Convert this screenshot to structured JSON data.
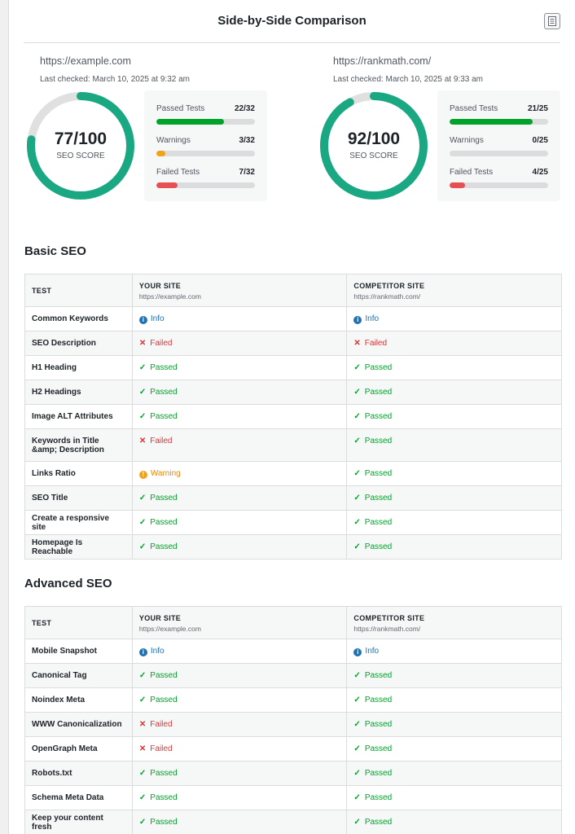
{
  "title": "Side-by-Side Comparison",
  "colors": {
    "passed": "#00a32a",
    "failed": "#d63638",
    "warning": "#f0a31a",
    "info": "#2271b1",
    "gauge": "#19a882"
  },
  "sites": [
    {
      "url": "https://example.com",
      "last_checked": "Last checked: March 10, 2025 at 9:32 am",
      "score": "77/100",
      "score_value": 77,
      "score_label": "SEO SCORE",
      "stats": [
        {
          "label": "Passed Tests",
          "value": "22/32",
          "fraction": 0.6875,
          "color": "#00a32a"
        },
        {
          "label": "Warnings",
          "value": "3/32",
          "fraction": 0.094,
          "color": "#f0a31a"
        },
        {
          "label": "Failed Tests",
          "value": "7/32",
          "fraction": 0.219,
          "color": "#e65054"
        }
      ]
    },
    {
      "url": "https://rankmath.com/",
      "last_checked": "Last checked: March 10, 2025 at 9:33 am",
      "score": "92/100",
      "score_value": 92,
      "score_label": "SEO SCORE",
      "stats": [
        {
          "label": "Passed Tests",
          "value": "21/25",
          "fraction": 0.84,
          "color": "#00a32a"
        },
        {
          "label": "Warnings",
          "value": "0/25",
          "fraction": 0.0,
          "color": "#f0a31a"
        },
        {
          "label": "Failed Tests",
          "value": "4/25",
          "fraction": 0.16,
          "color": "#e65054"
        }
      ]
    }
  ],
  "table_headers": {
    "test": "TEST",
    "your_site": "YOUR SITE",
    "your_site_url": "https://example.com",
    "competitor_site": "COMPETITOR SITE",
    "competitor_site_url": "https://rankmath.com/"
  },
  "sections": [
    {
      "title": "Basic SEO",
      "rows": [
        {
          "test": "Common Keywords",
          "yours": "Info",
          "competitor": "Info"
        },
        {
          "test": "SEO Description",
          "yours": "Failed",
          "competitor": "Failed"
        },
        {
          "test": "H1 Heading",
          "yours": "Passed",
          "competitor": "Passed"
        },
        {
          "test": "H2 Headings",
          "yours": "Passed",
          "competitor": "Passed"
        },
        {
          "test": "Image ALT Attributes",
          "yours": "Passed",
          "competitor": "Passed"
        },
        {
          "test": "Keywords in Title &amp; Description",
          "yours": "Failed",
          "competitor": "Passed",
          "tall": true
        },
        {
          "test": "Links Ratio",
          "yours": "Warning",
          "competitor": "Passed"
        },
        {
          "test": "SEO Title",
          "yours": "Passed",
          "competitor": "Passed"
        },
        {
          "test": "Create a responsive site",
          "yours": "Passed",
          "competitor": "Passed"
        },
        {
          "test": "Homepage Is Reachable",
          "yours": "Passed",
          "competitor": "Passed"
        }
      ]
    },
    {
      "title": "Advanced SEO",
      "rows": [
        {
          "test": "Mobile Snapshot",
          "yours": "Info",
          "competitor": "Info"
        },
        {
          "test": "Canonical Tag",
          "yours": "Passed",
          "competitor": "Passed"
        },
        {
          "test": "Noindex Meta",
          "yours": "Passed",
          "competitor": "Passed"
        },
        {
          "test": "WWW Canonicalization",
          "yours": "Failed",
          "competitor": "Passed"
        },
        {
          "test": "OpenGraph Meta",
          "yours": "Failed",
          "competitor": "Passed"
        },
        {
          "test": "Robots.txt",
          "yours": "Passed",
          "competitor": "Passed"
        },
        {
          "test": "Schema Meta Data",
          "yours": "Passed",
          "competitor": "Passed"
        },
        {
          "test": "Keep your content fresh",
          "yours": "Passed",
          "competitor": "Passed"
        }
      ]
    }
  ]
}
